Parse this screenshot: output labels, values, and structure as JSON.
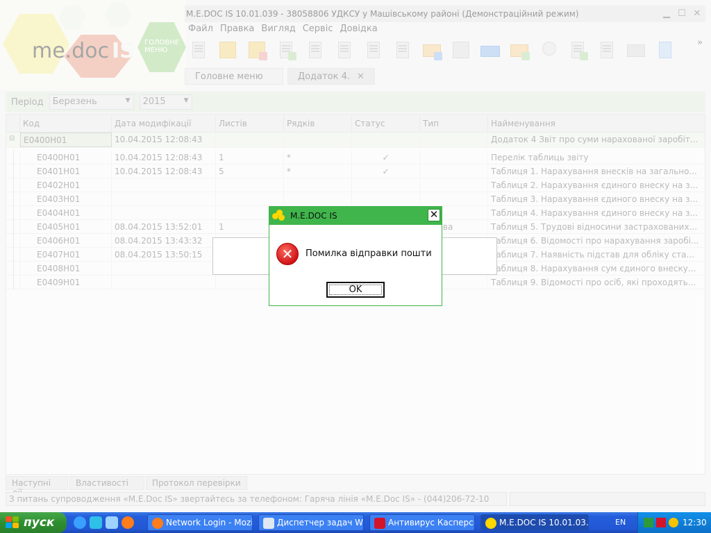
{
  "app": {
    "logo_text": "me.doc",
    "logo_is": "IS",
    "home_menu_label": "ГОЛОВНЕ МЕНЮ",
    "window_title": "M.E.DOC IS 10.01.039  - 38058806 УДКСУ у Машівському районі (Демонстраційний режим)",
    "menu": [
      "Файл",
      "Правка",
      "Вигляд",
      "Сервіс",
      "Довідка"
    ],
    "tabs": [
      {
        "label": "Головне меню"
      },
      {
        "label": "Додаток 4."
      }
    ],
    "tab_close_glyph": "✕",
    "toolbar_more": "»"
  },
  "filter": {
    "period_label": "Період",
    "month": "Березень",
    "year": "2015"
  },
  "grid": {
    "columns": [
      "Код",
      "Дата модифікації",
      "Листів",
      "Рядків",
      "Статус",
      "Тип",
      "Найменування"
    ],
    "parent": {
      "code": "E0400H01",
      "date": "10.04.2015 12:08:43",
      "sheets": "",
      "rows": "",
      "status": "",
      "type": "",
      "name": "Додаток 4 Звіт про суми нарахованої заробіт..."
    },
    "rows": [
      {
        "code": "E0400H01",
        "date": "10.04.2015 12:08:43",
        "sheets": "1",
        "rows": "*",
        "status": "✓",
        "type": "",
        "name": "Перелік таблиць звіту"
      },
      {
        "code": "E0401H01",
        "date": "10.04.2015 12:08:43",
        "sheets": "5",
        "rows": "*",
        "status": "✓",
        "type": "",
        "name": "Таблиця 1. Нарахування внесків на загально..."
      },
      {
        "code": "E0402H01",
        "date": "",
        "sheets": "",
        "rows": "",
        "status": "",
        "type": "",
        "name": "Таблиця 2. Нарахування єдиного внеску на з..."
      },
      {
        "code": "E0403H01",
        "date": "",
        "sheets": "",
        "rows": "",
        "status": "",
        "type": "",
        "name": "Таблиця 3. Нарахування єдиного внеску на з..."
      },
      {
        "code": "E0404H01",
        "date": "",
        "sheets": "",
        "rows": "",
        "status": "",
        "type": "",
        "name": "Таблиця 4. Нарахування єдиного внеску на з..."
      },
      {
        "code": "E0405H01",
        "date": "08.04.2015 13:52:01",
        "sheets": "1",
        "rows": "",
        "status": "",
        "type": "атко‍ва",
        "name": "Таблиця 5. Трудові відносини застрахованих..."
      },
      {
        "code": "E0406H01",
        "date": "08.04.2015 13:43:32",
        "sheets": "",
        "rows": "",
        "status": "",
        "type": "",
        "name": "Таблиця 6. Відомості про нарахування заробі..."
      },
      {
        "code": "E0407H01",
        "date": "08.04.2015 13:50:15",
        "sheets": "",
        "rows": "",
        "status": "",
        "type": "",
        "name": "Таблиця 7. Наявність підстав для обліку ста..."
      },
      {
        "code": "E0408H01",
        "date": "",
        "sheets": "",
        "rows": "",
        "status": "",
        "type": "",
        "name": "Таблиця 8. Нарахування сум єдиного внеску..."
      },
      {
        "code": "E0409H01",
        "date": "",
        "sheets": "",
        "rows": "",
        "status": "",
        "type": "",
        "name": "Таблиця 9. Відомості про осіб, які проходять..."
      }
    ]
  },
  "bottom_tabs": [
    "Наступні дії",
    "Властивості",
    "Протокол перевірки"
  ],
  "status_text": "З питань супроводження «M.E.Doc IS» звертайтесь за телефоном: Гаряча лінія «M.E.Doc IS» - (044)206-72-10",
  "dialog": {
    "title": "M.E.DOC IS",
    "close_glyph": "✕",
    "message": "Помилка відправки пошти",
    "error_glyph": "✕",
    "ok_label": "OK"
  },
  "taskbar": {
    "start_label": "пуск",
    "tasks": [
      {
        "label": "Network Login - Mozill...",
        "icon": "firefox-icon"
      },
      {
        "label": "Диспетчер задач Wi...",
        "icon": "task-manager-icon"
      },
      {
        "label": "Антивирус Касперск...",
        "icon": "kaspersky-icon"
      },
      {
        "label": "M.E.DOC IS 10.01.03...",
        "icon": "medoc-icon"
      }
    ],
    "language": "EN",
    "clock": "12:30"
  }
}
